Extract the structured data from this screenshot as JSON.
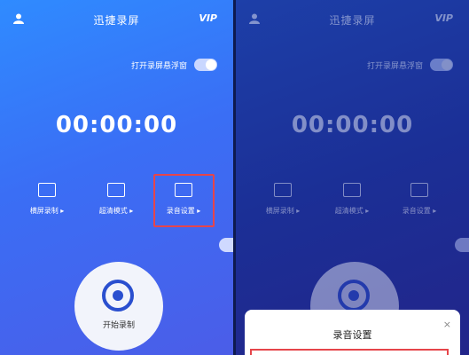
{
  "app_title": "迅捷录屏",
  "vip_label": "VIP",
  "float_window_label": "打开录屏悬浮窗",
  "timer": "00:00:00",
  "options": [
    {
      "label": "横屏录制 ▸"
    },
    {
      "label": "超清模式 ▸"
    },
    {
      "label": "录音设置 ▸"
    }
  ],
  "record_button_label": "开始录制",
  "dialog": {
    "title": "录音设置",
    "close": "×"
  },
  "colors": {
    "highlight": "#e6454a",
    "accent": "#2a4fcf"
  }
}
